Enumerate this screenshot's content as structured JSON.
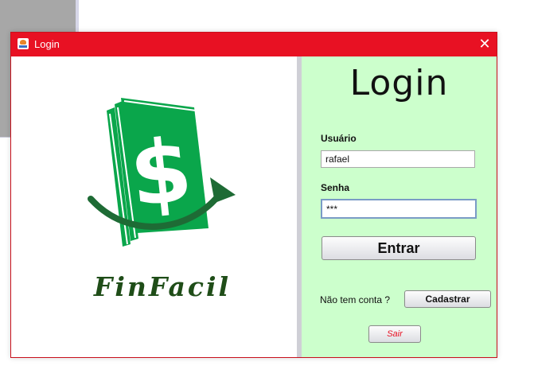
{
  "window": {
    "title": "Login",
    "title_icon": "java-cup-icon",
    "close_icon": "close-icon",
    "close_glyph": "✕",
    "accent_color": "#e81123"
  },
  "logo": {
    "brand_name": "FinFacil",
    "symbol": "$",
    "colors": {
      "note": "#0aa64b",
      "arrow": "#1e6b35",
      "text": "#1f4d18"
    }
  },
  "form": {
    "heading": "Login",
    "username_label": "Usuário",
    "username_value": "rafael",
    "password_label": "Senha",
    "password_value": "***",
    "submit_label": "Entrar",
    "no_account_text": "Não tem conta ?",
    "register_label": "Cadastrar",
    "exit_label": "Sair",
    "panel_color": "#ccffcc"
  }
}
